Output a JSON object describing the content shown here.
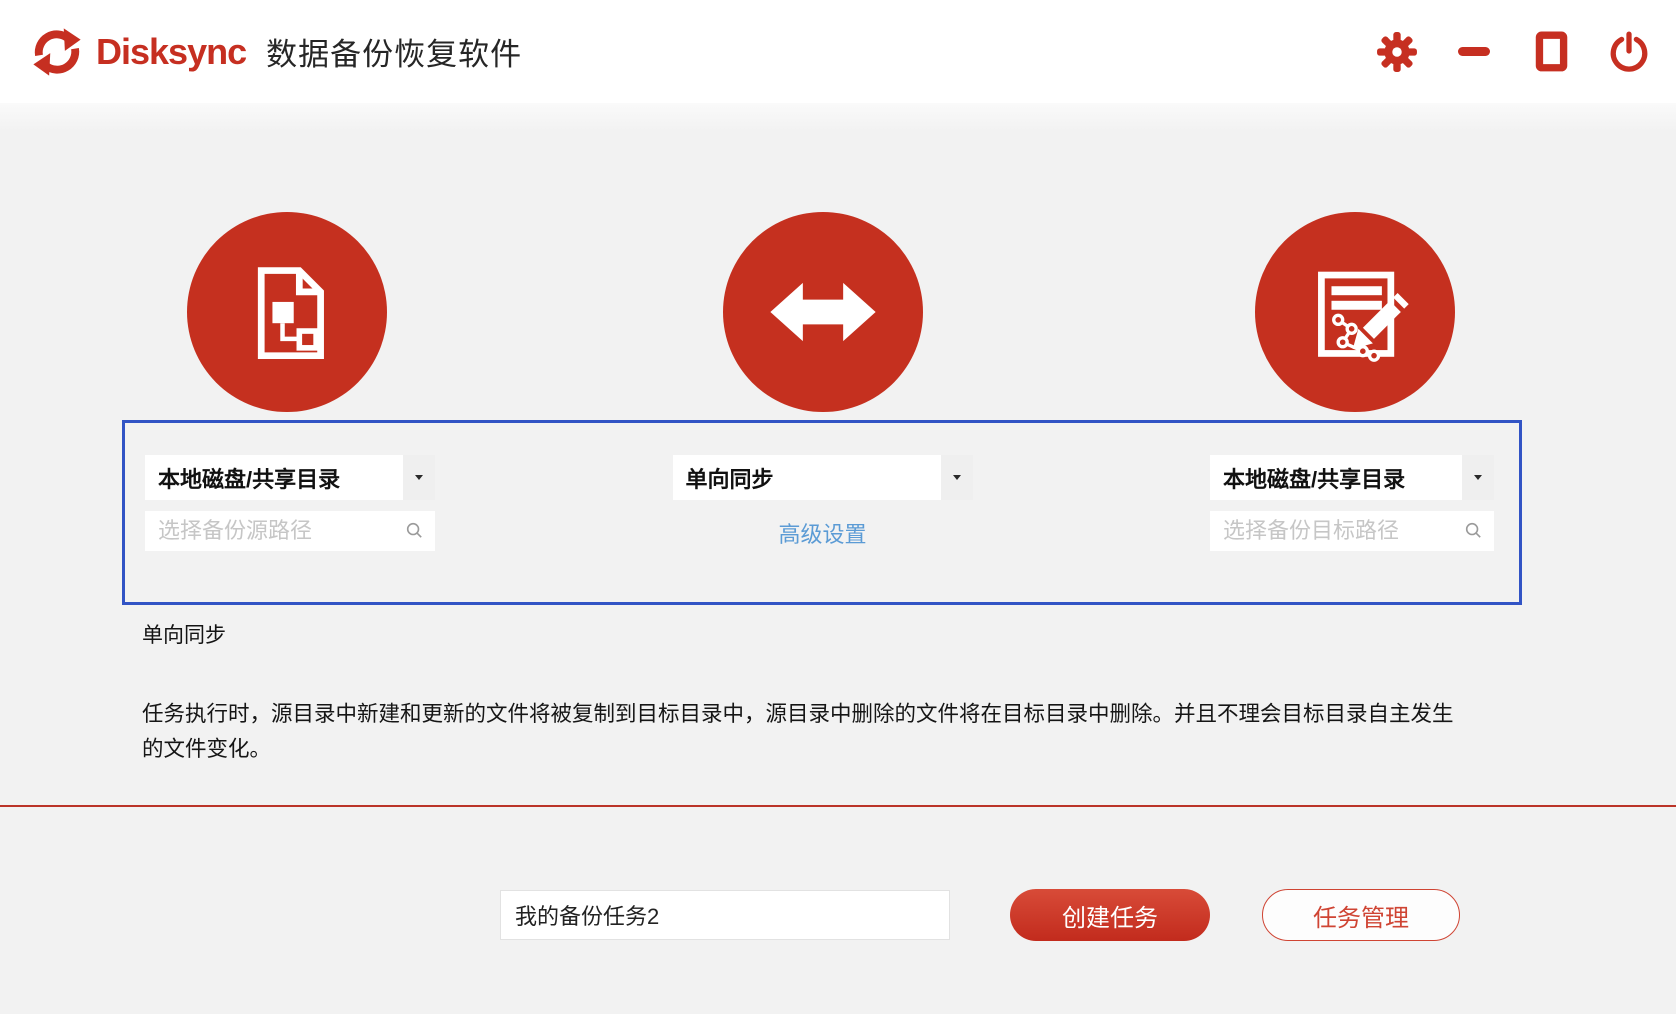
{
  "header": {
    "brand": "Disksync",
    "title": "数据备份恢复软件"
  },
  "panel": {
    "source": {
      "type_selected": "本地磁盘/共享目录",
      "path_placeholder": "选择备份源路径"
    },
    "mode": {
      "selected": "单向同步",
      "advanced_link": "高级设置"
    },
    "target": {
      "type_selected": "本地磁盘/共享目录",
      "path_placeholder": "选择备份目标路径"
    }
  },
  "info": {
    "mode_label": "单向同步",
    "description": "任务执行时，源目录中新建和更新的文件将被复制到目标目录中，源目录中删除的文件将在目标目录中删除。并且不理会目标目录自主发生的文件变化。"
  },
  "footer": {
    "task_name_value": "我的备份任务2",
    "create_button": "创建任务",
    "manage_button": "任务管理"
  },
  "colors": {
    "brand_red": "#c62f21",
    "circle_red": "#c5301f",
    "panel_border_blue": "#3254c5",
    "advanced_link_blue": "#5b9bd5",
    "divider_red": "#bb3428",
    "background_gray": "#f2f2f2"
  }
}
